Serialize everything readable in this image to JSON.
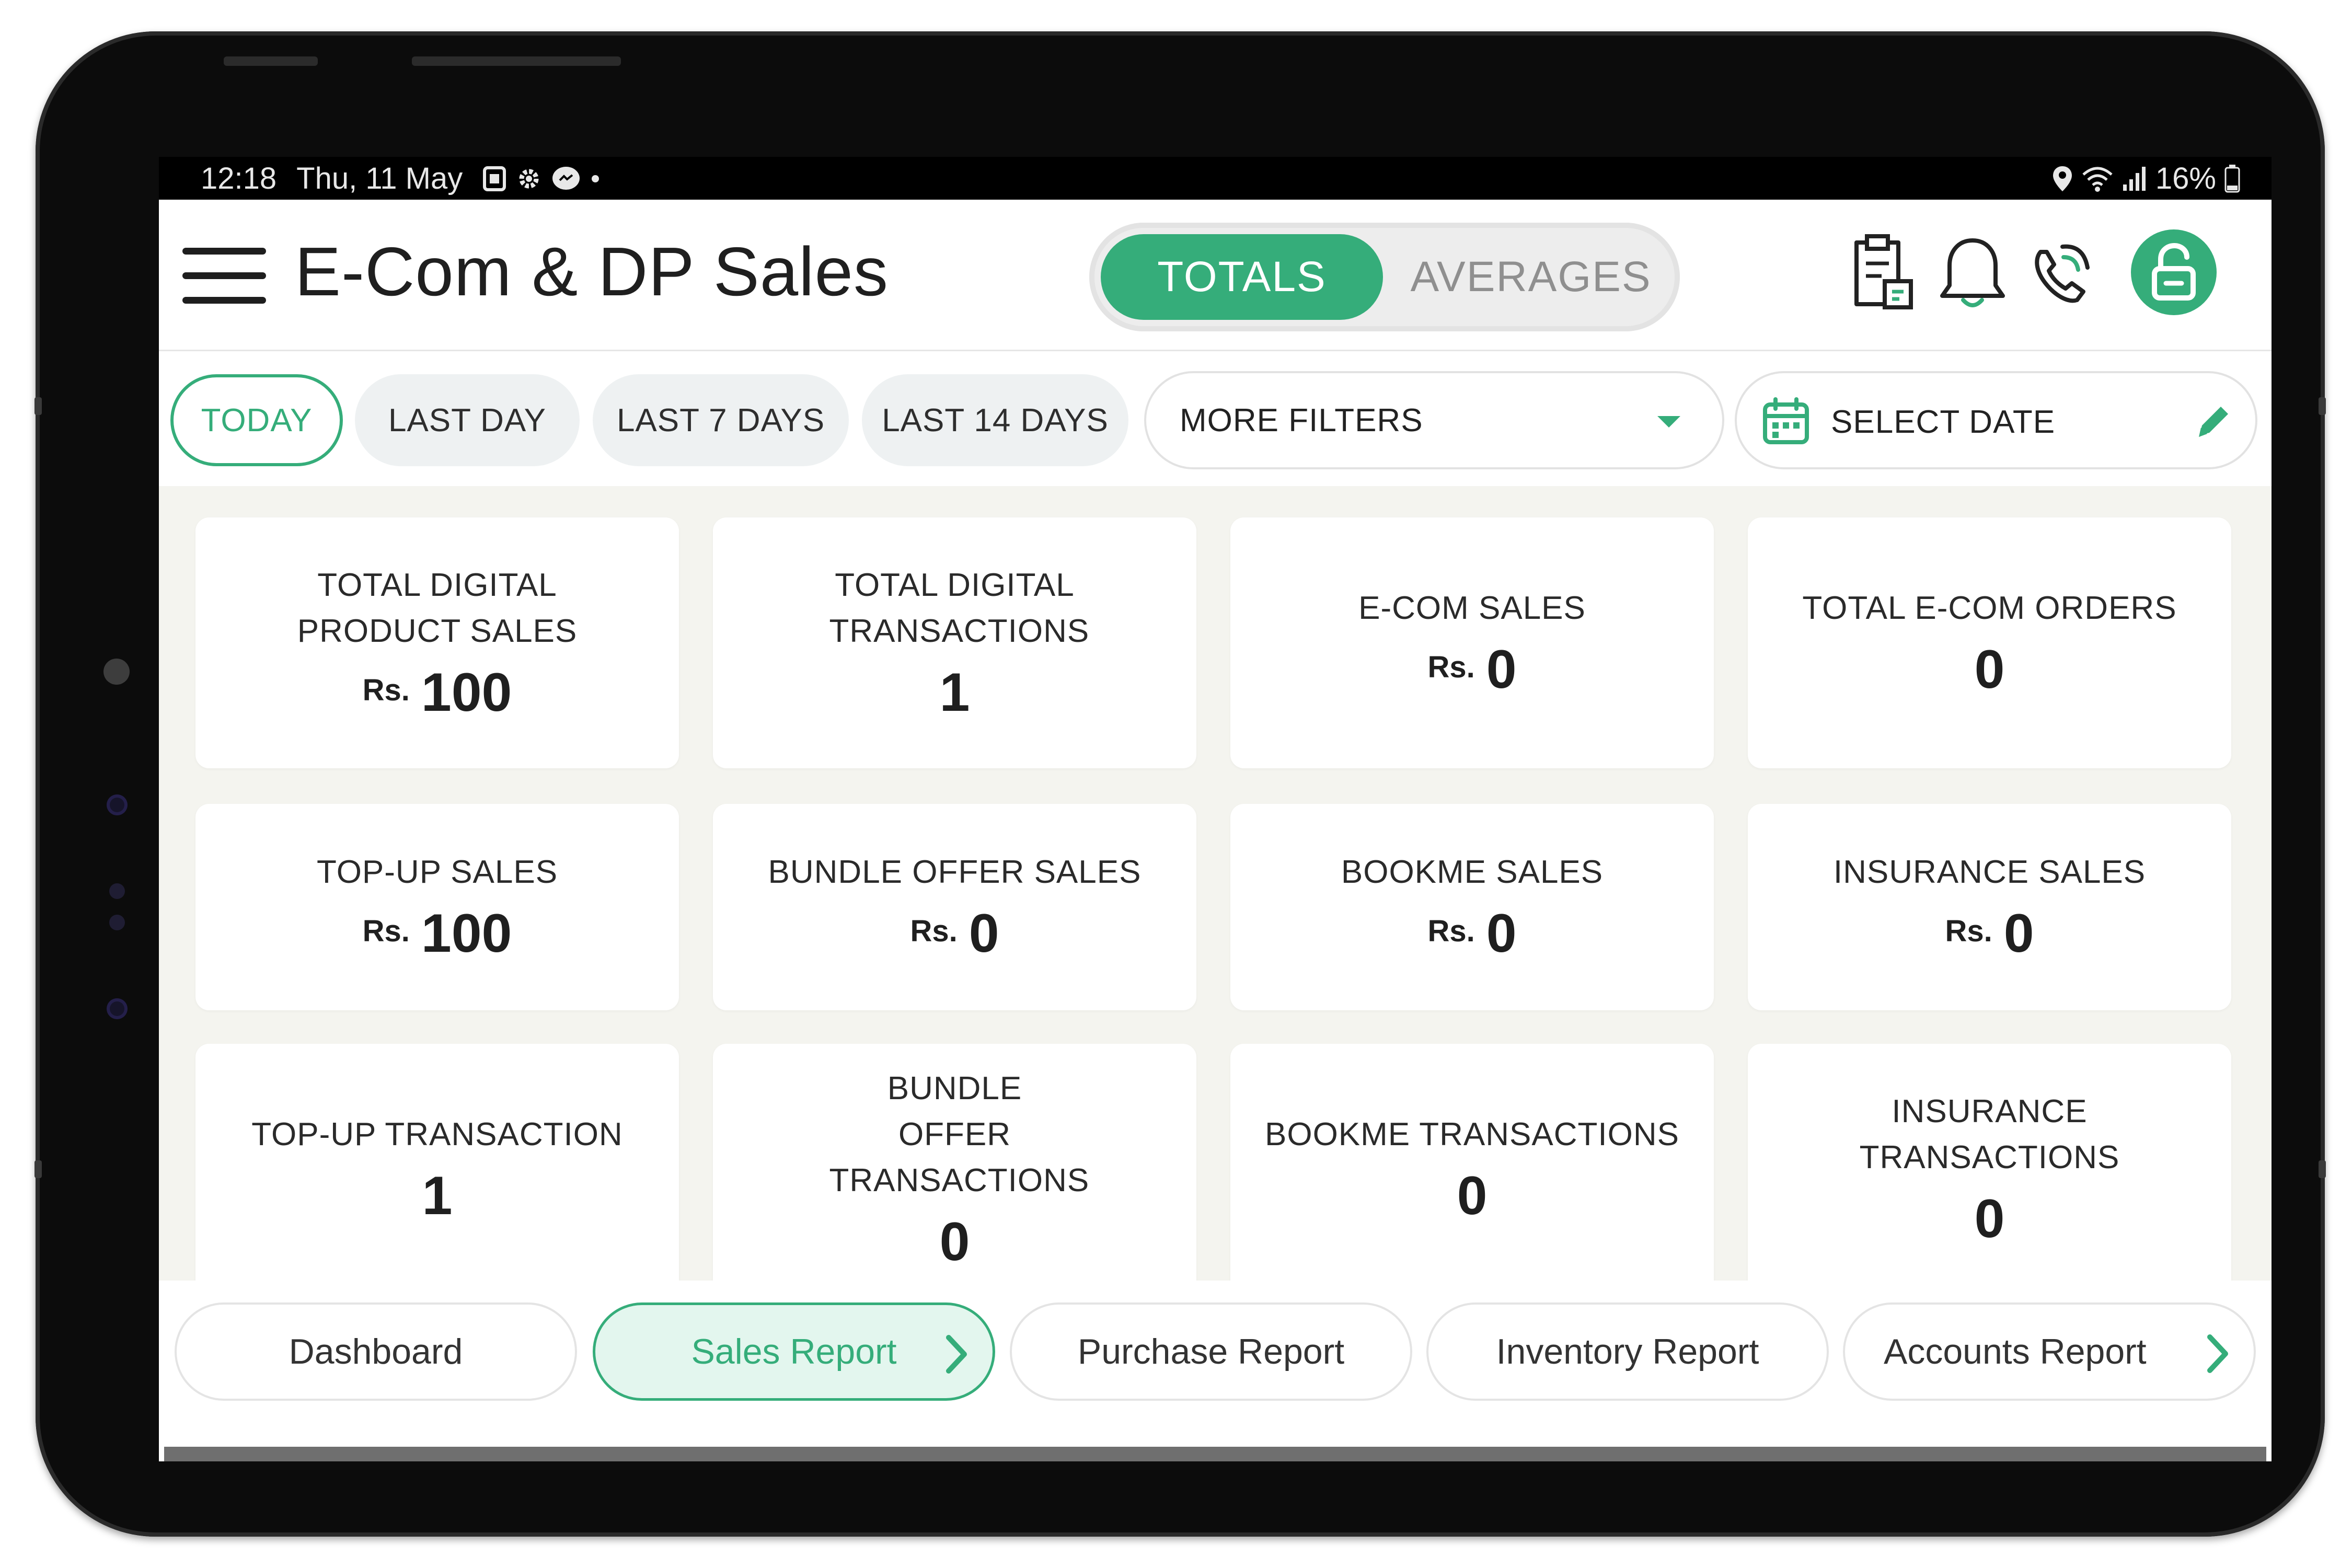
{
  "status_bar": {
    "time": "12:18",
    "date": "Thu, 11 May",
    "battery": "16%",
    "icons": [
      "sim-icon",
      "settings-icon",
      "messenger-icon",
      "dot-icon"
    ],
    "right_icons": [
      "location-icon",
      "wifi-icon",
      "signal-icon",
      "battery-icon"
    ]
  },
  "header": {
    "title": "E-Com & DP Sales",
    "toggle": {
      "totals": "TOTALS",
      "averages": "AVERAGES",
      "selected": "totals"
    },
    "icons": [
      "report-icon",
      "bell-icon",
      "support-phone-icon",
      "unlock-icon"
    ]
  },
  "filters": {
    "chips": [
      {
        "label": "TODAY",
        "active": true
      },
      {
        "label": "LAST DAY",
        "active": false
      },
      {
        "label": "LAST 7 DAYS",
        "active": false
      },
      {
        "label": "LAST 14 DAYS",
        "active": false
      }
    ],
    "more_filters": "MORE FILTERS",
    "select_date": "SELECT DATE"
  },
  "cards": [
    {
      "title": "TOTAL DIGITAL PRODUCT SALES",
      "currency": "Rs.",
      "value": "100"
    },
    {
      "title": "TOTAL DIGITAL TRANSACTIONS",
      "currency": "",
      "value": "1"
    },
    {
      "title": "E-COM SALES",
      "currency": "Rs.",
      "value": "0"
    },
    {
      "title": "TOTAL E-COM ORDERS",
      "currency": "",
      "value": "0"
    },
    {
      "title": "TOP-UP SALES",
      "currency": "Rs.",
      "value": "100"
    },
    {
      "title": "BUNDLE OFFER SALES",
      "currency": "Rs.",
      "value": "0"
    },
    {
      "title": "BOOKME SALES",
      "currency": "Rs.",
      "value": "0"
    },
    {
      "title": "INSURANCE SALES",
      "currency": "Rs.",
      "value": "0"
    },
    {
      "title": "TOP-UP TRANSACTION",
      "currency": "",
      "value": "1"
    },
    {
      "title": "BUNDLE OFFER TRANSACTIONS",
      "currency": "",
      "value": "0"
    },
    {
      "title": "BOOKME TRANSACTIONS",
      "currency": "",
      "value": "0"
    },
    {
      "title": "INSURANCE TRANSACTIONS",
      "currency": "",
      "value": "0"
    }
  ],
  "bottom_nav": [
    {
      "label": "Dashboard",
      "active": false
    },
    {
      "label": "Sales Report",
      "active": true
    },
    {
      "label": "Purchase Report",
      "active": false
    },
    {
      "label": "Inventory Report",
      "active": false
    },
    {
      "label": "Accounts Report",
      "active": false
    }
  ],
  "colors": {
    "accent": "#35ad7a",
    "background": "#f4f4ef",
    "chip": "#eef1f2",
    "text": "#1f1f1f"
  }
}
